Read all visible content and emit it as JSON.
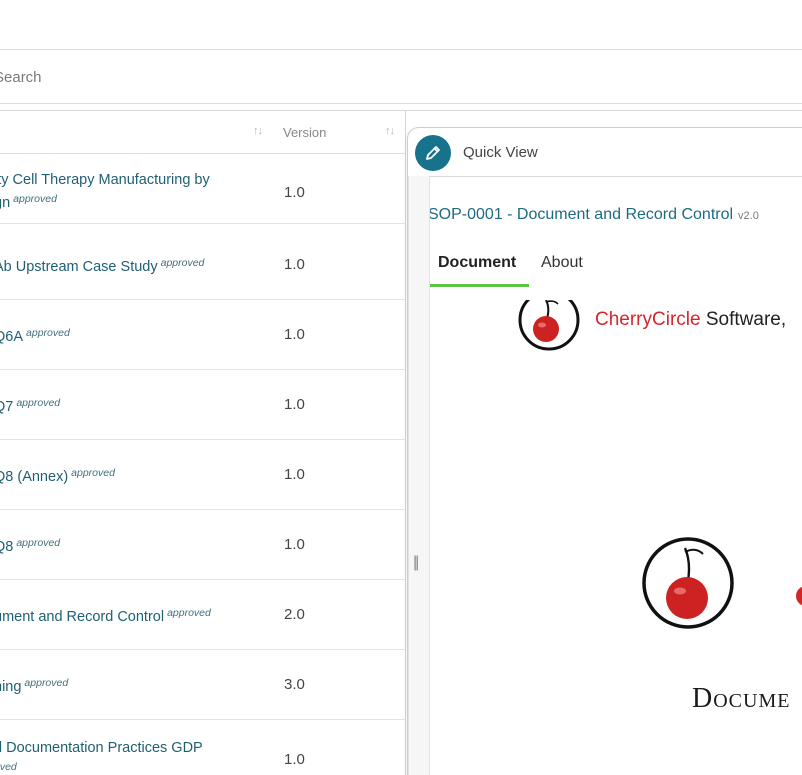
{
  "search": {
    "placeholder": "Search"
  },
  "table": {
    "version_header": "Version",
    "sort_icon": "sort-icon",
    "rows": [
      {
        "title": "ity Cell Therapy Manufacturing by",
        "title2": "gn",
        "status": "approved",
        "version": "1.0"
      },
      {
        "title": "Ab Upstream Case Study",
        "status": "approved",
        "version": "1.0"
      },
      {
        "title": "Q6A",
        "status": "approved",
        "version": "1.0"
      },
      {
        "title": "Q7",
        "status": "approved",
        "version": "1.0"
      },
      {
        "title": "Q8 (Annex)",
        "status": "approved",
        "version": "1.0"
      },
      {
        "title": "Q8",
        "status": "approved",
        "version": "1.0"
      },
      {
        "title": "ument and Record Control",
        "status": "approved",
        "version": "2.0"
      },
      {
        "title": "ning",
        "status": "approved",
        "version": "3.0"
      },
      {
        "title": "d Documentation Practices GDP",
        "title2": "",
        "status": "oved",
        "version": "1.0"
      }
    ]
  },
  "quick_view": {
    "label": "Quick View",
    "edit_icon": "pencil-icon",
    "doc_title": "SOP-0001 - Document and Record Control",
    "doc_version": "v2.0",
    "tabs": [
      {
        "label": "Document"
      },
      {
        "label": "About"
      }
    ],
    "splitter_grip": "||"
  },
  "document": {
    "brand_red": "CherryCircle",
    "brand_black": " Software,",
    "heading": "Docume",
    "logo_icon": "cherry-logo-icon"
  },
  "colors": {
    "accent": "#17728b",
    "link": "#1e5f73",
    "tab_active": "#5dc44a",
    "brand_red": "#d6262c"
  }
}
